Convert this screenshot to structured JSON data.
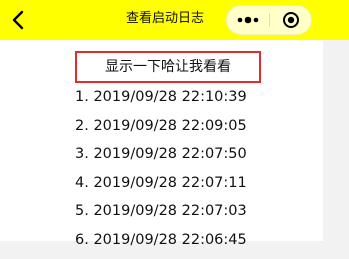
{
  "nav": {
    "title": "查看启动日志",
    "background_color": "#ffff00",
    "back_icon": "chevron-left-icon",
    "capsule_more_icon": "more-dots-icon",
    "capsule_close_icon": "target-circle-icon"
  },
  "main": {
    "show_button_label": "显示一下哈让我看看",
    "show_button_border_color": "#e02c2c",
    "logs": [
      "1. 2019/09/28 22:10:39",
      "2. 2019/09/28 22:09:05",
      "3. 2019/09/28 22:07:50",
      "4. 2019/09/28 22:07:11",
      "5. 2019/09/28 22:07:03",
      "6. 2019/09/28 22:06:45"
    ]
  }
}
